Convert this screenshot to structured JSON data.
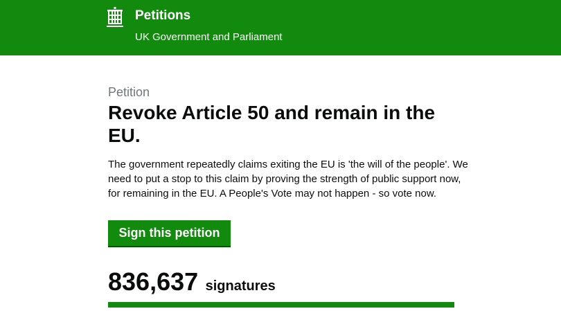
{
  "header": {
    "title": "Petitions",
    "subtitle": "UK Government and Parliament",
    "logo_icon": "portcullis-crest-icon",
    "background_color": "#118a0e"
  },
  "petition": {
    "caption": "Petition",
    "title": "Revoke Article 50 and remain in the EU.",
    "description": "The government repeatedly claims exiting the EU is 'the will of the people'. We need to put a stop to this claim by proving the strength of public support now, for remaining in the EU. A People's Vote may not happen - so vote now.",
    "sign_button_label": "Sign this petition",
    "signature_count": "836,637",
    "signature_label": "signatures",
    "progress_fraction": 1.0
  },
  "colors": {
    "brand_green": "#118a0e",
    "text": "#0b0c0c",
    "caption_grey": "#6f777b"
  }
}
